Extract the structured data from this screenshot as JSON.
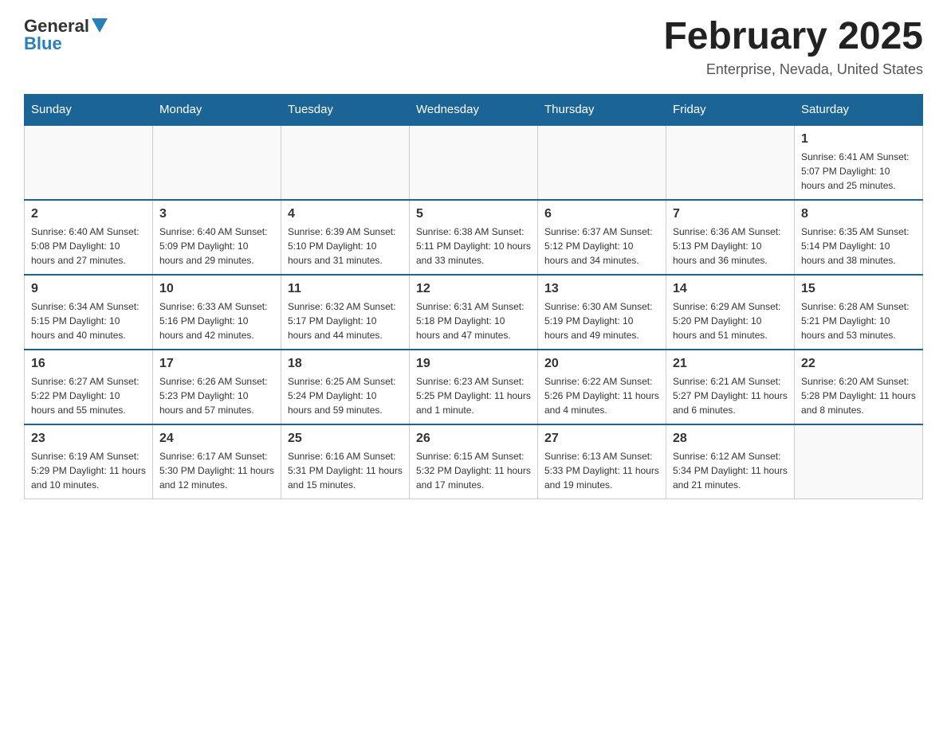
{
  "header": {
    "logo": {
      "general": "General",
      "blue": "Blue"
    },
    "title": "February 2025",
    "subtitle": "Enterprise, Nevada, United States"
  },
  "calendar": {
    "days_of_week": [
      "Sunday",
      "Monday",
      "Tuesday",
      "Wednesday",
      "Thursday",
      "Friday",
      "Saturday"
    ],
    "weeks": [
      [
        {
          "day": "",
          "info": ""
        },
        {
          "day": "",
          "info": ""
        },
        {
          "day": "",
          "info": ""
        },
        {
          "day": "",
          "info": ""
        },
        {
          "day": "",
          "info": ""
        },
        {
          "day": "",
          "info": ""
        },
        {
          "day": "1",
          "info": "Sunrise: 6:41 AM\nSunset: 5:07 PM\nDaylight: 10 hours and 25 minutes."
        }
      ],
      [
        {
          "day": "2",
          "info": "Sunrise: 6:40 AM\nSunset: 5:08 PM\nDaylight: 10 hours and 27 minutes."
        },
        {
          "day": "3",
          "info": "Sunrise: 6:40 AM\nSunset: 5:09 PM\nDaylight: 10 hours and 29 minutes."
        },
        {
          "day": "4",
          "info": "Sunrise: 6:39 AM\nSunset: 5:10 PM\nDaylight: 10 hours and 31 minutes."
        },
        {
          "day": "5",
          "info": "Sunrise: 6:38 AM\nSunset: 5:11 PM\nDaylight: 10 hours and 33 minutes."
        },
        {
          "day": "6",
          "info": "Sunrise: 6:37 AM\nSunset: 5:12 PM\nDaylight: 10 hours and 34 minutes."
        },
        {
          "day": "7",
          "info": "Sunrise: 6:36 AM\nSunset: 5:13 PM\nDaylight: 10 hours and 36 minutes."
        },
        {
          "day": "8",
          "info": "Sunrise: 6:35 AM\nSunset: 5:14 PM\nDaylight: 10 hours and 38 minutes."
        }
      ],
      [
        {
          "day": "9",
          "info": "Sunrise: 6:34 AM\nSunset: 5:15 PM\nDaylight: 10 hours and 40 minutes."
        },
        {
          "day": "10",
          "info": "Sunrise: 6:33 AM\nSunset: 5:16 PM\nDaylight: 10 hours and 42 minutes."
        },
        {
          "day": "11",
          "info": "Sunrise: 6:32 AM\nSunset: 5:17 PM\nDaylight: 10 hours and 44 minutes."
        },
        {
          "day": "12",
          "info": "Sunrise: 6:31 AM\nSunset: 5:18 PM\nDaylight: 10 hours and 47 minutes."
        },
        {
          "day": "13",
          "info": "Sunrise: 6:30 AM\nSunset: 5:19 PM\nDaylight: 10 hours and 49 minutes."
        },
        {
          "day": "14",
          "info": "Sunrise: 6:29 AM\nSunset: 5:20 PM\nDaylight: 10 hours and 51 minutes."
        },
        {
          "day": "15",
          "info": "Sunrise: 6:28 AM\nSunset: 5:21 PM\nDaylight: 10 hours and 53 minutes."
        }
      ],
      [
        {
          "day": "16",
          "info": "Sunrise: 6:27 AM\nSunset: 5:22 PM\nDaylight: 10 hours and 55 minutes."
        },
        {
          "day": "17",
          "info": "Sunrise: 6:26 AM\nSunset: 5:23 PM\nDaylight: 10 hours and 57 minutes."
        },
        {
          "day": "18",
          "info": "Sunrise: 6:25 AM\nSunset: 5:24 PM\nDaylight: 10 hours and 59 minutes."
        },
        {
          "day": "19",
          "info": "Sunrise: 6:23 AM\nSunset: 5:25 PM\nDaylight: 11 hours and 1 minute."
        },
        {
          "day": "20",
          "info": "Sunrise: 6:22 AM\nSunset: 5:26 PM\nDaylight: 11 hours and 4 minutes."
        },
        {
          "day": "21",
          "info": "Sunrise: 6:21 AM\nSunset: 5:27 PM\nDaylight: 11 hours and 6 minutes."
        },
        {
          "day": "22",
          "info": "Sunrise: 6:20 AM\nSunset: 5:28 PM\nDaylight: 11 hours and 8 minutes."
        }
      ],
      [
        {
          "day": "23",
          "info": "Sunrise: 6:19 AM\nSunset: 5:29 PM\nDaylight: 11 hours and 10 minutes."
        },
        {
          "day": "24",
          "info": "Sunrise: 6:17 AM\nSunset: 5:30 PM\nDaylight: 11 hours and 12 minutes."
        },
        {
          "day": "25",
          "info": "Sunrise: 6:16 AM\nSunset: 5:31 PM\nDaylight: 11 hours and 15 minutes."
        },
        {
          "day": "26",
          "info": "Sunrise: 6:15 AM\nSunset: 5:32 PM\nDaylight: 11 hours and 17 minutes."
        },
        {
          "day": "27",
          "info": "Sunrise: 6:13 AM\nSunset: 5:33 PM\nDaylight: 11 hours and 19 minutes."
        },
        {
          "day": "28",
          "info": "Sunrise: 6:12 AM\nSunset: 5:34 PM\nDaylight: 11 hours and 21 minutes."
        },
        {
          "day": "",
          "info": ""
        }
      ]
    ]
  }
}
